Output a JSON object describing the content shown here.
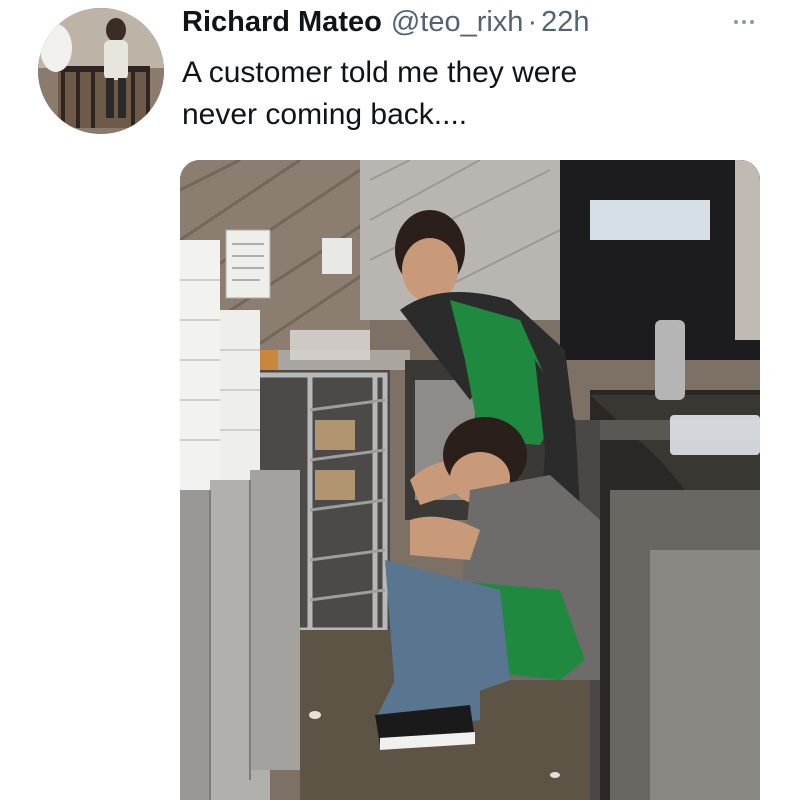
{
  "tweet": {
    "author": {
      "display_name": "Richard Mateo",
      "handle": "@teo_rixh",
      "separator": "·",
      "time": "22h",
      "avatar_icon": "profile-photo"
    },
    "text": "A customer told me they were\nnever coming back....",
    "more_icon": "more-options-icon",
    "media": {
      "type": "photo",
      "apron_color": "#1f8a3f",
      "shirt_color": "#2b2b2b"
    }
  },
  "colors": {
    "text_primary": "#0f1419",
    "text_secondary": "#536471",
    "background": "#ffffff"
  }
}
